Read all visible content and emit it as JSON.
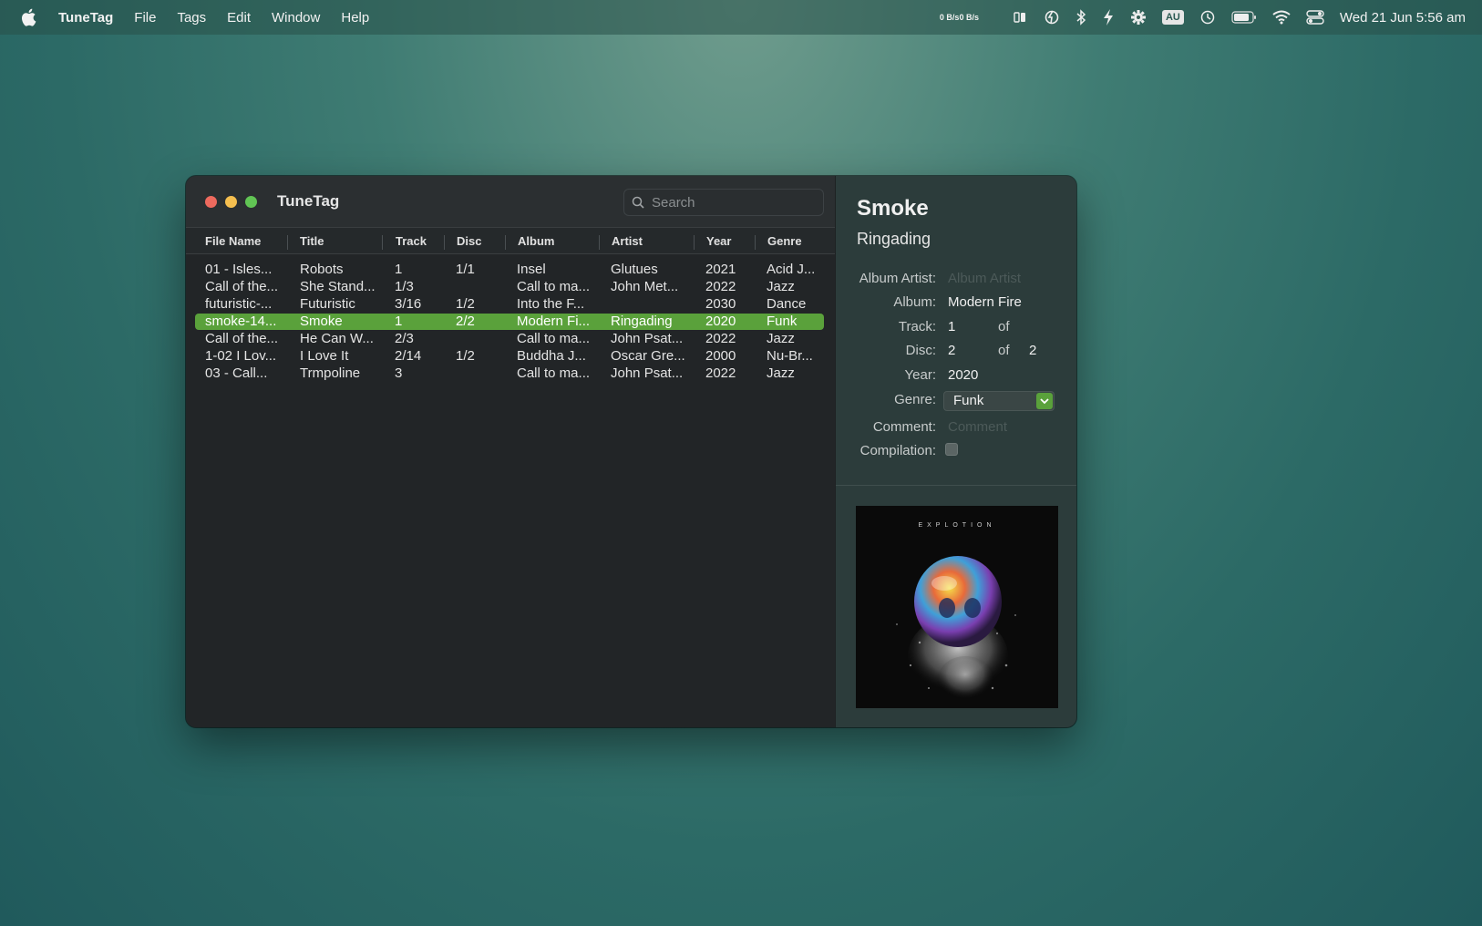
{
  "menubar": {
    "app_name": "TuneTag",
    "menus": [
      "File",
      "Tags",
      "Edit",
      "Window",
      "Help"
    ],
    "netspeed_up": "0 B/s",
    "netspeed_down": "0 B/s",
    "input_badge": "AU",
    "clock": "Wed 21 Jun  5:56 am"
  },
  "window": {
    "title": "TuneTag",
    "search_placeholder": "Search"
  },
  "table": {
    "columns": [
      "File Name",
      "Title",
      "Track",
      "Disc",
      "Album",
      "Artist",
      "Year",
      "Genre"
    ],
    "rows": [
      [
        "01 - Isles...",
        "Robots",
        "1",
        "1/1",
        "Insel",
        "Glutues",
        "2021",
        "Acid J..."
      ],
      [
        "Call of the...",
        "She Stand...",
        "1/3",
        "",
        "Call to ma...",
        "John Met...",
        "2022",
        "Jazz"
      ],
      [
        "futuristic-...",
        "Futuristic",
        "3/16",
        "1/2",
        "Into the F...",
        "",
        "2030",
        "Dance"
      ],
      [
        "smoke-14...",
        "Smoke",
        "1",
        "2/2",
        "Modern Fi...",
        "Ringading",
        "2020",
        "Funk"
      ],
      [
        "Call of the...",
        "He Can W...",
        "2/3",
        "",
        "Call to ma...",
        "John Psat...",
        "2022",
        "Jazz"
      ],
      [
        "1-02 I Lov...",
        "I Love It",
        "2/14",
        "1/2",
        "Buddha J...",
        "Oscar Gre...",
        "2000",
        "Nu-Br..."
      ],
      [
        "03 - Call...",
        "Trmpoline",
        "3",
        "",
        "Call to ma...",
        "John Psat...",
        "2022",
        "Jazz"
      ]
    ],
    "selected_index": 3
  },
  "inspector": {
    "title": "Smoke",
    "artist": "Ringading",
    "labels": {
      "album_artist": "Album Artist:",
      "album": "Album:",
      "track": "Track:",
      "disc": "Disc:",
      "year": "Year:",
      "genre": "Genre:",
      "comment": "Comment:",
      "compilation": "Compilation:"
    },
    "album_artist_placeholder": "Album Artist",
    "album": "Modern Fire",
    "track": "1",
    "track_total": "",
    "of_label": "of",
    "disc": "2",
    "disc_total": "2",
    "year": "2020",
    "genre": "Funk",
    "comment_placeholder": "Comment",
    "compilation": false,
    "artwork_text": "EXPLOTION"
  },
  "colors": {
    "accent": "#5aa13b",
    "close": "#ed6a5e",
    "minimize": "#f5bf4f",
    "maximize": "#61c554"
  }
}
